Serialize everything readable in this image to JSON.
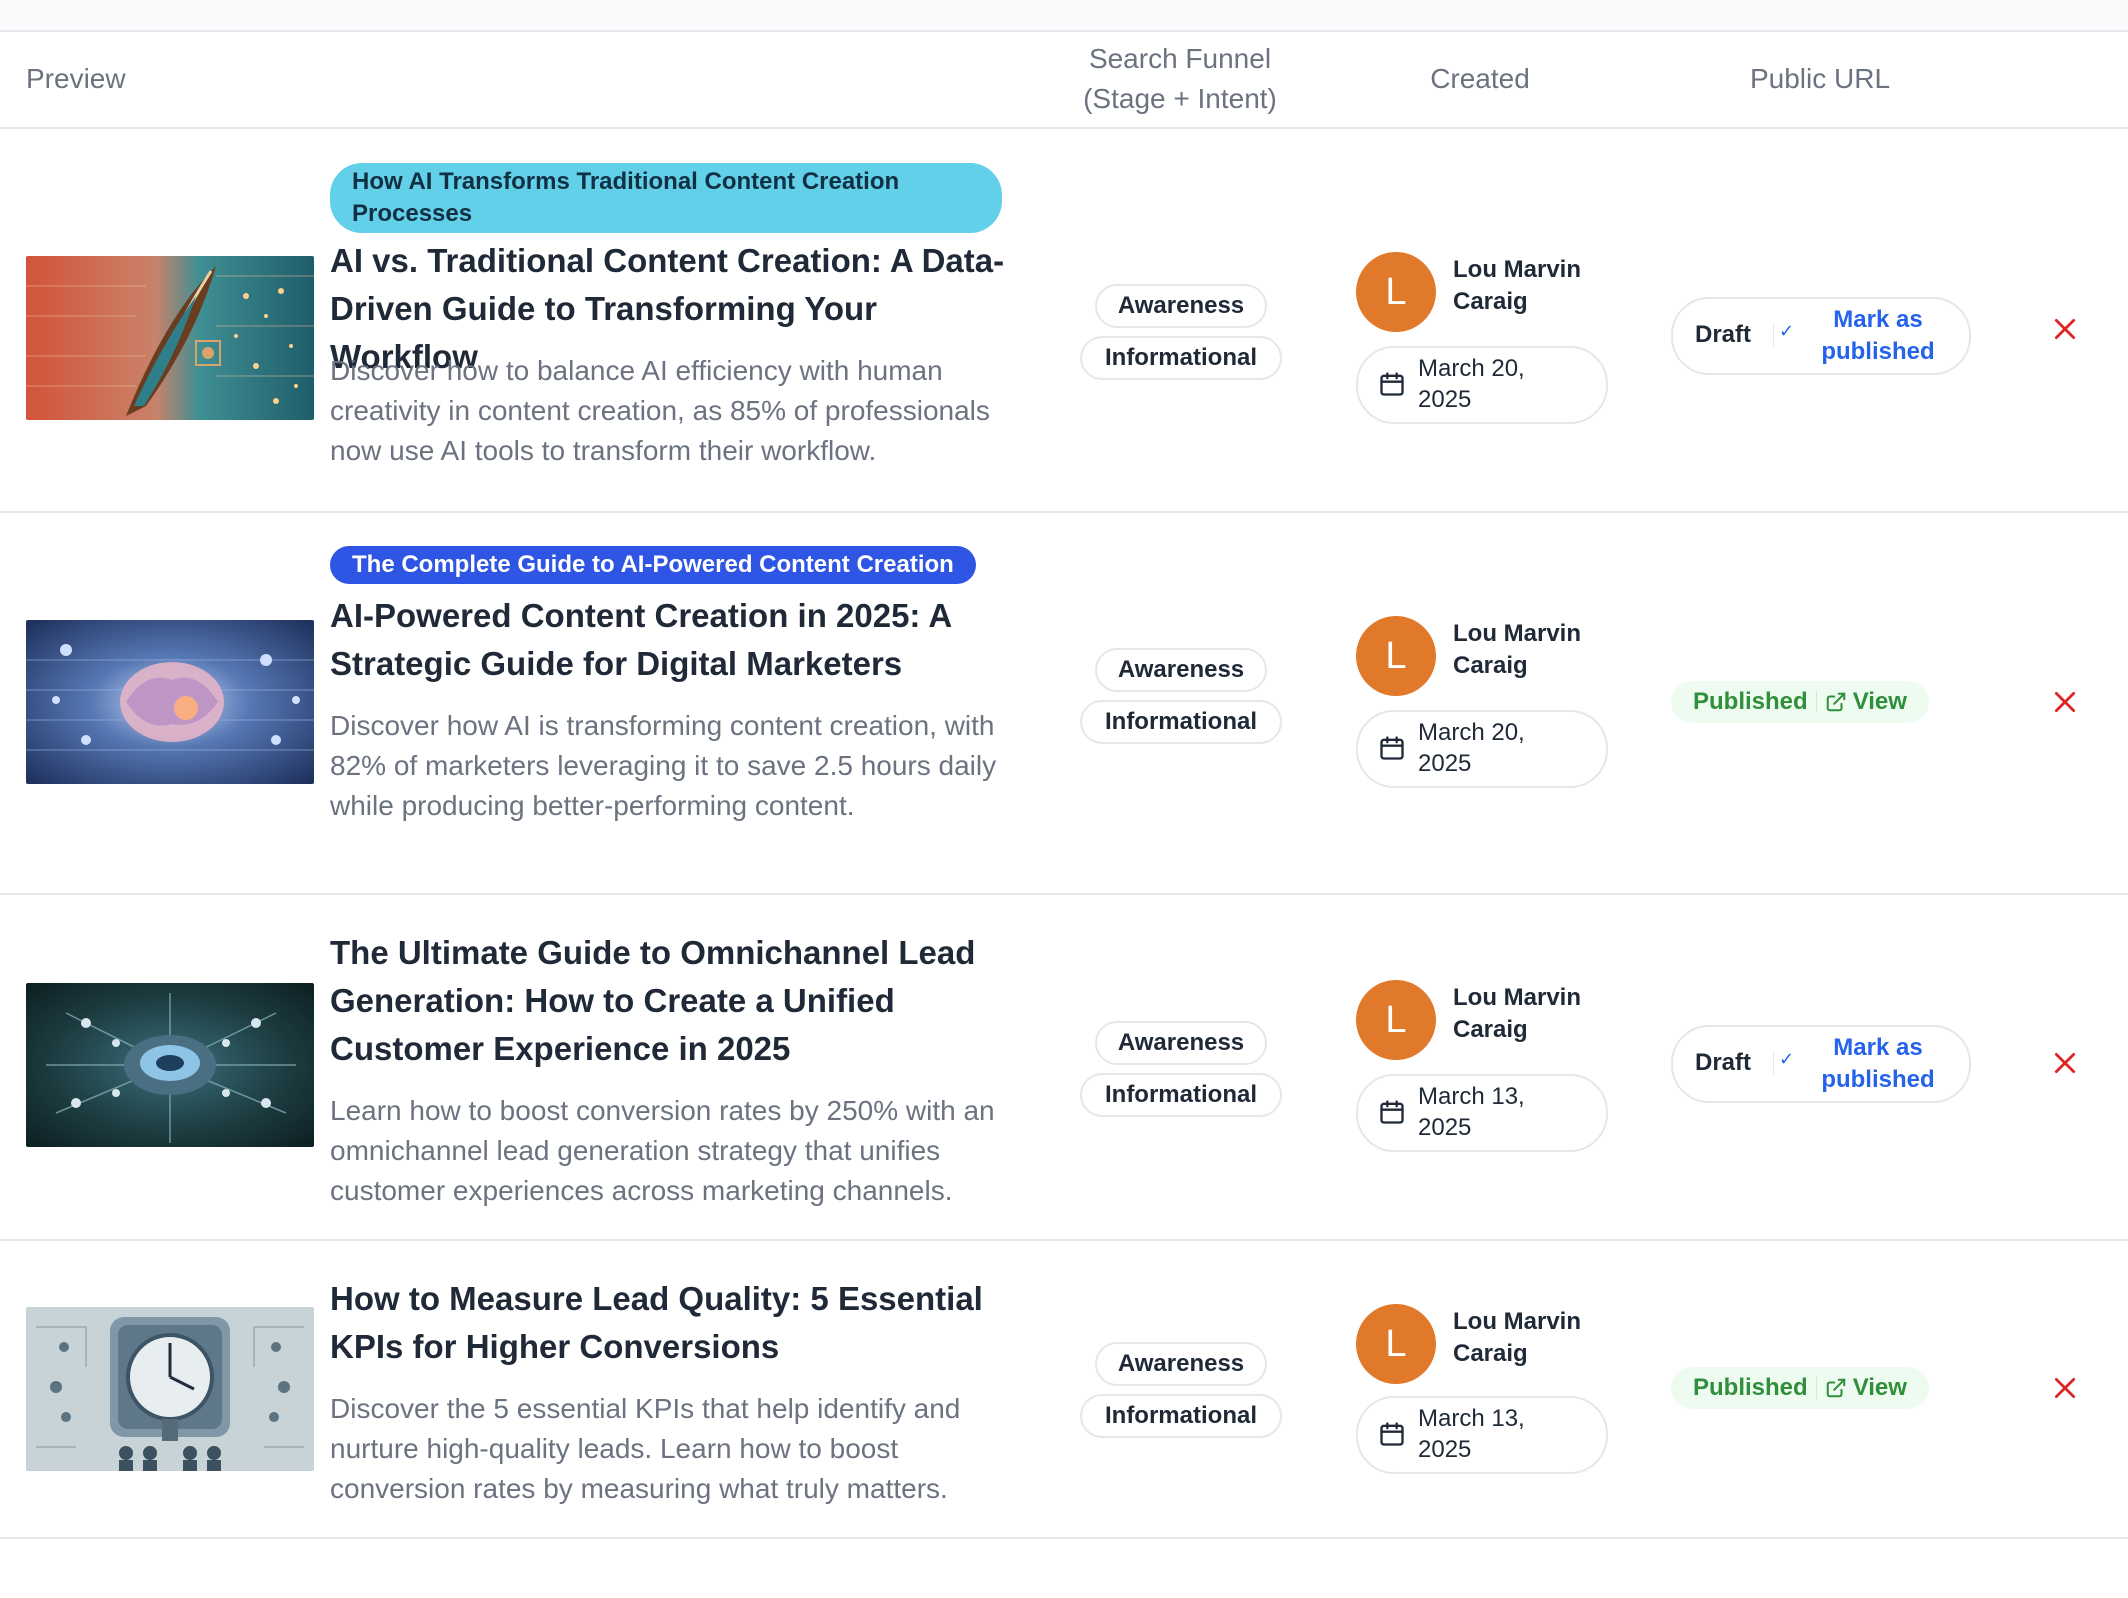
{
  "table": {
    "headers": {
      "preview": "Preview",
      "funnel_line1": "Search Funnel",
      "funnel_line2": "(Stage + Intent)",
      "created": "Created",
      "public_url": "Public URL"
    }
  },
  "rows": [
    {
      "tag": "How AI Transforms Traditional Content Creation Processes",
      "title": "AI vs. Traditional Content Creation: A Data-Driven Guide to Transforming Your Workflow",
      "description": "Discover how to balance AI efficiency with human creativity in content creation, as 85% of professionals now use AI tools to transform their workflow.",
      "stage": "Awareness",
      "intent": "Informational",
      "avatar_initial": "L",
      "author": "Lou Marvin Caraig",
      "date_line1": "March 20,",
      "date_line2": "2025",
      "status": "Draft",
      "action": "Mark as published"
    },
    {
      "tag": "The Complete Guide to AI-Powered Content Creation",
      "title": "AI-Powered Content Creation in 2025: A Strategic Guide for Digital Marketers",
      "description": "Discover how AI is transforming content creation, with 82% of marketers leveraging it to save 2.5 hours daily while producing better-performing content.",
      "stage": "Awareness",
      "intent": "Informational",
      "avatar_initial": "L",
      "author": "Lou Marvin Caraig",
      "date_line1": "March 20,",
      "date_line2": "2025",
      "status": "Published",
      "action": "View"
    },
    {
      "title": "The Ultimate Guide to Omnichannel Lead Generation: How to Create a Unified Customer Experience in 2025",
      "description": "Learn how to boost conversion rates by 250% with an omnichannel lead generation strategy that unifies customer experiences across marketing channels.",
      "stage": "Awareness",
      "intent": "Informational",
      "avatar_initial": "L",
      "author": "Lou Marvin Caraig",
      "date_line1": "March 13,",
      "date_line2": "2025",
      "status": "Draft",
      "action": "Mark as published"
    },
    {
      "title": "How to Measure Lead Quality: 5 Essential KPIs for Higher Conversions",
      "description": "Discover the 5 essential KPIs that help identify and nurture high-quality leads. Learn how to boost conversion rates by measuring what truly matters.",
      "stage": "Awareness",
      "intent": "Informational",
      "avatar_initial": "L",
      "author": "Lou Marvin Caraig",
      "date_line1": "March 13,",
      "date_line2": "2025",
      "status": "Published",
      "action": "View"
    }
  ],
  "colors": {
    "tag_cyan": "#62d0e8",
    "tag_blue": "#2f55e4",
    "avatar": "#e07a2a",
    "link_blue": "#2563eb",
    "published_green": "#2f8f3a",
    "delete_red": "#dc2626"
  },
  "icons": [
    "calendar-icon",
    "check-icon",
    "external-link-icon",
    "close-icon"
  ]
}
